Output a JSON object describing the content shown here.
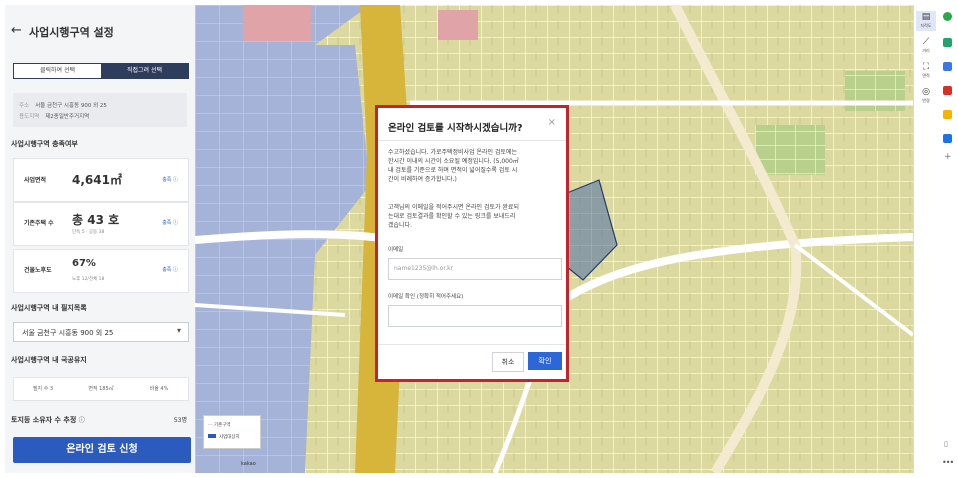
{
  "panel": {
    "title": "사업시행구역 설정",
    "toggle": [
      "클릭하여 선택",
      "직접그려 선택"
    ],
    "address": {
      "label1": "주소",
      "value1": "서울 금천구 시흥동 900 외 25",
      "label2": "용도지역",
      "value2": "제2종일반주거지역"
    },
    "section_area": "사업시행구역 충족여부",
    "stats": [
      {
        "label": "사업면적",
        "value": "4,641㎡",
        "sub": "",
        "link": "충족 ⓘ"
      },
      {
        "label": "기존주택 수",
        "value": "총 43 호",
        "sub": "단독 5 · 공동 38",
        "link": "충족 ⓘ"
      },
      {
        "label": "건물노후도",
        "value": "67%",
        "sub": "노후 12/전체 18",
        "link": "충족 ⓘ"
      }
    ],
    "section_parcels": "사업시행구역 내 필지목록",
    "select_value": "서울 금천구 시흥동 900 외 25",
    "section_state": "사업시행구역 내 국공유지",
    "mini": [
      "필지 수 3",
      "면적 185㎡",
      "비율 4%"
    ],
    "owners_label": "토지등 소유자 수 추정",
    "owners_count": "53명",
    "apply_button": "온라인 검토 신청"
  },
  "map": {
    "legend": [
      "기존구역",
      "사업대상지"
    ],
    "scale": "kakao"
  },
  "toolbar": [
    {
      "icon": "layers-icon",
      "label": "지적도"
    },
    {
      "icon": "ruler-icon",
      "label": "거리"
    },
    {
      "icon": "area-icon",
      "label": "면적"
    },
    {
      "icon": "target-icon",
      "label": "반경"
    }
  ],
  "modal": {
    "title": "온라인 검토를 시작하시겠습니까?",
    "close": "×",
    "text1": "수고하셨습니다. 가로주택정비사업 온라인 검토에는\n한시간 이내의 시간이 소요될 예정입니다. (5,000㎡\n내 검토를 기준으로 하며 면적이 넓어질수록 검토 시\n간이 비례하여 증가합니다.)",
    "text2": "고객님의 이메일을 적어주시면 온라인 검토가 완료되\n는대로 검토결과를 확인할 수 있는 링크를 보내드리\n겠습니다.",
    "email_label": "이메일",
    "email_placeholder": "name1235@lh.or.kr",
    "confirm_label": "이메일 확인 (정확히 적어주세요)",
    "confirm_placeholder": "",
    "cancel": "취소",
    "ok": "확인"
  },
  "colors": {
    "accent": "#2c5bbf",
    "modal_border": "#c4232c",
    "parcel_yellow": "#dcd9a0",
    "parcel_blue": "#a6b3d8"
  }
}
